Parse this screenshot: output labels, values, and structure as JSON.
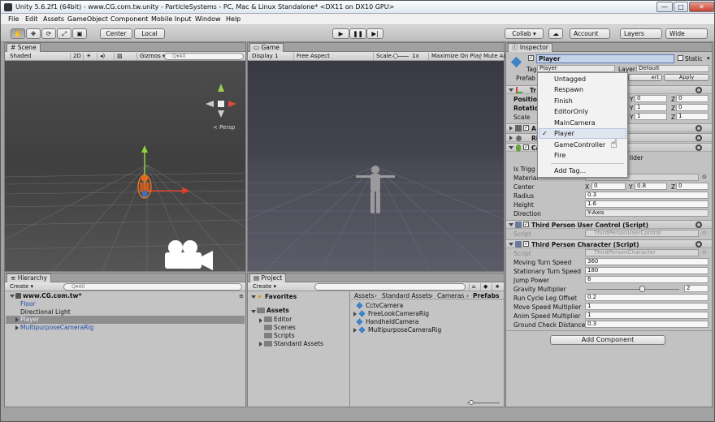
{
  "window": {
    "title": "Unity 5.6.2f1 (64bit) - www.CG.com.tw.unity - ParticleSystems - PC, Mac & Linux Standalone* <DX11 on DX10 GPU>",
    "min": "—",
    "max": "□",
    "close": "✕"
  },
  "menu": [
    "File",
    "Edit",
    "Assets",
    "GameObject",
    "Component",
    "Mobile Input",
    "Window",
    "Help"
  ],
  "toolbar": {
    "center": "Center",
    "local": "Local",
    "collab": "Collab ▾",
    "account": "Account",
    "layers": "Layers",
    "layout": "Wide"
  },
  "scene": {
    "tab": "Scene",
    "shaded": "Shaded",
    "mode2d": "2D",
    "gizmos": "Gizmos ▾",
    "search": "Q▾All",
    "persp": "< Persp"
  },
  "game": {
    "tab": "Game",
    "display": "Display 1",
    "aspect": "Free Aspect",
    "scale_label": "Scale",
    "scale_value": "1x",
    "maximize": "Maximize On Play",
    "mute": "Mute Au"
  },
  "hierarchy": {
    "tab": "Hierarchy",
    "create": "Create ▾",
    "search": "Q▾All",
    "scene_name": "www.CG.com.tw*",
    "items": [
      "Floor",
      "Directional Light",
      "Player",
      "MultipurposeCameraRig"
    ]
  },
  "project": {
    "tab": "Project",
    "create": "Create ▾",
    "favorites": "Favorites",
    "assets": "Assets",
    "folders": [
      "Editor",
      "Scenes",
      "Scripts",
      "Standard Assets"
    ],
    "breadcrumb": [
      "Assets",
      "Standard Assets",
      "Cameras",
      "Prefabs"
    ],
    "files": [
      "CctvCamera",
      "FreeLookCameraRig",
      "HandheldCamera",
      "MultipurposeCameraRig"
    ]
  },
  "inspector": {
    "tab": "Inspector",
    "name": "Player",
    "static": "Static",
    "tag_label": "Tag",
    "tag_value": "Player",
    "layer_label": "Layer",
    "layer_value": "Default",
    "prefab_label": "Prefab",
    "revert": "ert",
    "apply": "Apply",
    "transform": {
      "title": "Tr",
      "position": "Position",
      "rotation": "Rotatio",
      "scale": "Scale",
      "rows": [
        {
          "y": "0",
          "z": "0"
        },
        {
          "y": "1",
          "z": "0"
        },
        {
          "y": "1",
          "z": "1"
        }
      ]
    },
    "animator_short": "A",
    "rigidbody_short": "Ri",
    "capsule_short": "Ca",
    "collider_suffix": "lider",
    "capsule": {
      "is_trigger": "Is Trigg",
      "material": "Material",
      "center_label": "Center",
      "center": {
        "x": "0",
        "y": "0.8",
        "z": "0"
      },
      "radius_label": "Radius",
      "radius": "0.3",
      "height_label": "Height",
      "height": "1.6",
      "direction_label": "Direction",
      "direction": "Y-Axis"
    },
    "tpuc": {
      "title": "Third Person User Control (Script)",
      "script_label": "Script",
      "script": "ThirdPersonUserControl"
    },
    "tpc": {
      "title": "Third Person Character (Script)",
      "script_label": "Script",
      "script": "ThirdPersonCharacter",
      "fields": [
        {
          "label": "Moving Turn Speed",
          "value": "360"
        },
        {
          "label": "Stationary Turn Speed",
          "value": "180"
        },
        {
          "label": "Jump Power",
          "value": "6"
        },
        {
          "label": "Gravity Multiplier",
          "value": "2"
        },
        {
          "label": "Run Cycle Leg Offset",
          "value": "0.2"
        },
        {
          "label": "Move Speed Multiplier",
          "value": "1"
        },
        {
          "label": "Anim Speed Multiplier",
          "value": "1"
        },
        {
          "label": "Ground Check Distance",
          "value": "0.3"
        }
      ],
      "gravity_slider_fraction": 0.6
    },
    "add_component": "Add Component",
    "xyz": {
      "x": "X",
      "y": "Y",
      "z": "Z"
    }
  },
  "tag_menu": {
    "items": [
      "Untagged",
      "Respawn",
      "Finish",
      "EditorOnly",
      "MainCamera",
      "Player",
      "GameController",
      "Fire"
    ],
    "selected": "Player",
    "add": "Add Tag..."
  },
  "colors": {
    "scene_sky": "#4a4a4a",
    "game_sky": "#3d3d47",
    "selection": "#3e5f96",
    "inspector_name_bg": "#c6d4ea"
  }
}
